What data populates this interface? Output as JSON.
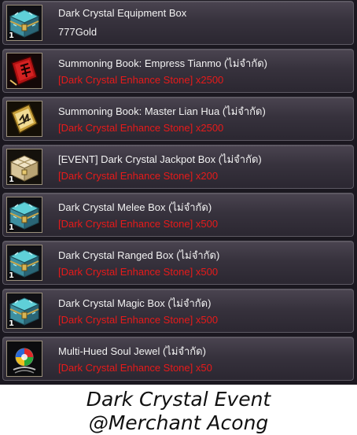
{
  "items": [
    {
      "name": "Dark Crystal Equipment Box",
      "price": "777Gold",
      "price_kind": "gold",
      "qty": "1",
      "icon": "crystal-chest-icon"
    },
    {
      "name": "Summoning Book: Empress Tianmo (ไม่จำกัด)",
      "price": "[Dark Crystal Enhance Stone] x2500",
      "price_kind": "item",
      "qty": "",
      "icon": "red-summoning-book-icon"
    },
    {
      "name": "Summoning Book: Master Lian Hua (ไม่จำกัด)",
      "price": "[Dark Crystal Enhance Stone] x2500",
      "price_kind": "item",
      "qty": "",
      "icon": "gold-summoning-book-icon"
    },
    {
      "name": "[EVENT] Dark Crystal Jackpot Box (ไม่จำกัด)",
      "price": "[Dark Crystal Enhance Stone] x200",
      "price_kind": "item",
      "qty": "1",
      "icon": "jackpot-box-icon"
    },
    {
      "name": "Dark Crystal Melee Box (ไม่จำกัด)",
      "price": "[Dark Crystal Enhance Stone] x500",
      "price_kind": "item",
      "qty": "1",
      "icon": "crystal-chest-icon"
    },
    {
      "name": "Dark Crystal Ranged Box (ไม่จำกัด)",
      "price": "[Dark Crystal Enhance Stone] x500",
      "price_kind": "item",
      "qty": "1",
      "icon": "crystal-chest-icon"
    },
    {
      "name": "Dark Crystal Magic Box (ไม่จำกัด)",
      "price": "[Dark Crystal Enhance Stone] x500",
      "price_kind": "item",
      "qty": "1",
      "icon": "crystal-chest-icon"
    },
    {
      "name": "Multi-Hued Soul Jewel (ไม่จำกัด)",
      "price": "[Dark Crystal Enhance Stone] x50",
      "price_kind": "item",
      "qty": "",
      "icon": "soul-jewel-icon"
    }
  ],
  "caption": {
    "line1": "Dark Crystal Event",
    "line2": "@Merchant Acong"
  },
  "colors": {
    "panel_bg": "#1b1820",
    "item_name": "#f2f2f2",
    "price_item": "#e81a1a",
    "price_gold": "#f2f2f2",
    "caption": "#111111"
  }
}
